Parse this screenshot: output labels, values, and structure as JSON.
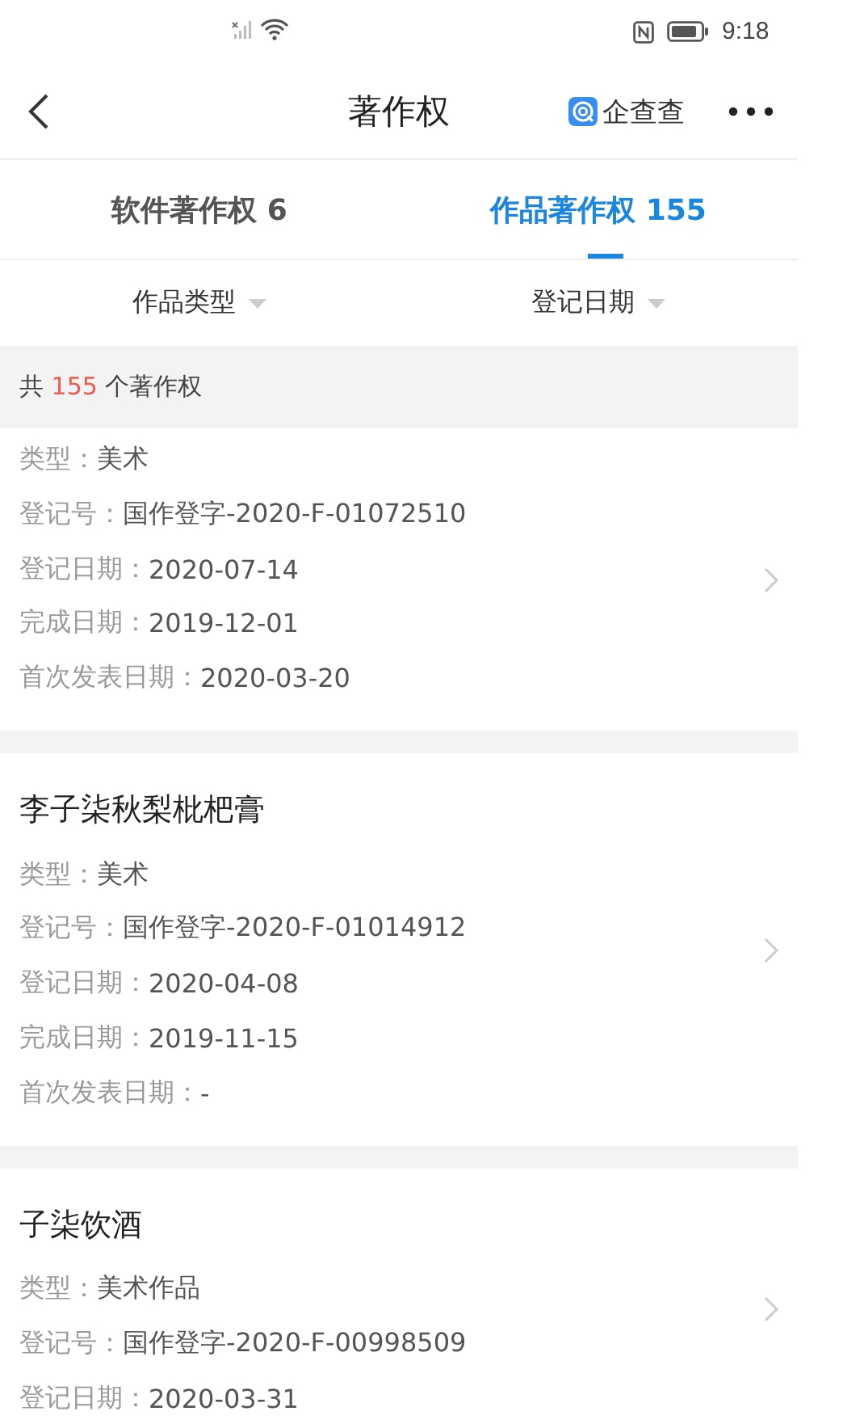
{
  "status_bar": {
    "time": "9:18"
  },
  "header": {
    "title": "著作权",
    "brand": "企查查"
  },
  "tabs": [
    {
      "label": "软件著作权",
      "count": "6",
      "selected": false
    },
    {
      "label": "作品著作权",
      "count": "155",
      "selected": true
    }
  ],
  "filters": [
    "作品类型",
    "登记日期"
  ],
  "summary": {
    "prefix": "共",
    "count": "155",
    "suffix": "个著作权"
  },
  "records": [
    {
      "fields": [
        {
          "label": "类型：",
          "value": "美术"
        },
        {
          "label": "登记号：",
          "value": "国作登字-2020-F-01072510"
        },
        {
          "label": "登记日期：",
          "value": "2020-07-14"
        },
        {
          "label": "完成日期：",
          "value": "2019-12-01"
        },
        {
          "label": "首次发表日期：",
          "value": "2020-03-20"
        }
      ]
    },
    {
      "title": "李子柒秋梨枇杷膏",
      "fields": [
        {
          "label": "类型：",
          "value": "美术"
        },
        {
          "label": "登记号：",
          "value": "国作登字-2020-F-01014912"
        },
        {
          "label": "登记日期：",
          "value": "2020-04-08"
        },
        {
          "label": "完成日期：",
          "value": "2019-11-15"
        },
        {
          "label": "首次发表日期：",
          "value": "-"
        }
      ]
    },
    {
      "title": "子柒饮酒",
      "fields": [
        {
          "label": "类型：",
          "value": "美术作品"
        },
        {
          "label": "登记号：",
          "value": "国作登字-2020-F-00998509"
        },
        {
          "label": "登记日期：",
          "value": "2020-03-31"
        }
      ]
    }
  ]
}
